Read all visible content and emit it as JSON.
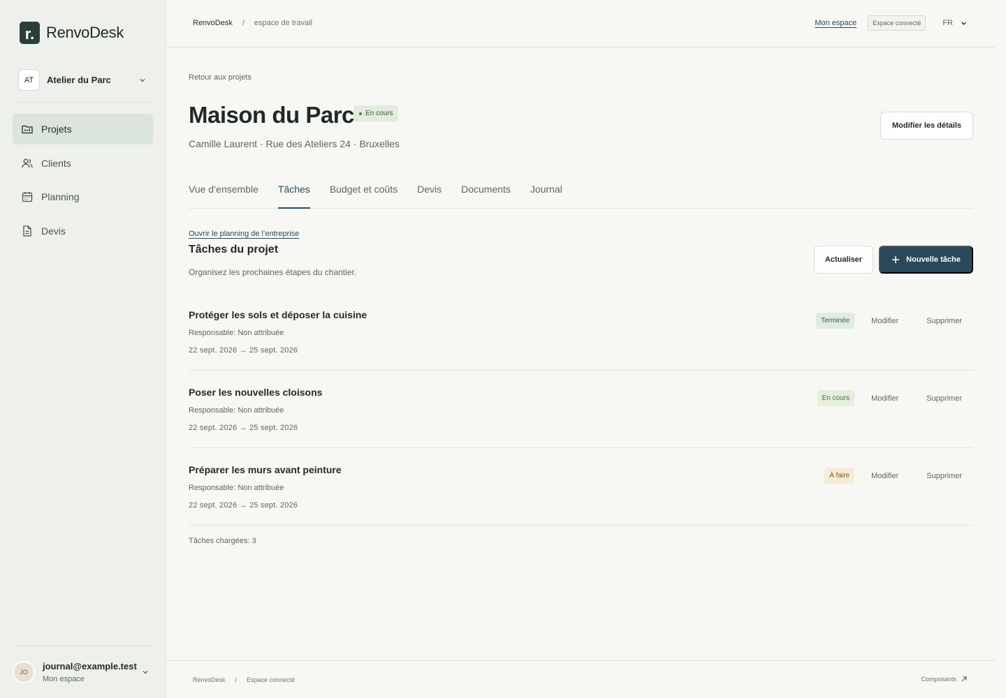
{
  "app": {
    "logo_letter": "r.",
    "name": "RenvoDesk"
  },
  "workspace": {
    "initials": "AT",
    "name": "Atelier du Parc"
  },
  "sidebar": {
    "items": [
      {
        "label": "Projets",
        "icon": "folder-icon",
        "active": true
      },
      {
        "label": "Clients",
        "icon": "users-icon",
        "active": false
      },
      {
        "label": "Planning",
        "icon": "calendar-icon",
        "active": false
      },
      {
        "label": "Devis",
        "icon": "document-icon",
        "active": false
      }
    ]
  },
  "user": {
    "initials": "JO",
    "email": "journal@example.test",
    "sub": "Mon espace"
  },
  "topbar": {
    "breadcrumb": [
      "RenvoDesk",
      "/",
      "espace de travail"
    ],
    "my_space": "Mon espace",
    "connected": "Espace connecté",
    "lang": "FR"
  },
  "project": {
    "back": "Retour aux projets",
    "title": "Maison du Parc",
    "status": "En cours",
    "subtitle": "Camille Laurent · Rue des Ateliers 24 · Bruxelles",
    "edit": "Modifier les détails"
  },
  "tabs": [
    {
      "label": "Vue d’ensemble",
      "active": false
    },
    {
      "label": "Tâches",
      "active": true
    },
    {
      "label": "Budget et coûts",
      "active": false
    },
    {
      "label": "Devis",
      "active": false
    },
    {
      "label": "Documents",
      "active": false
    },
    {
      "label": "Journal",
      "active": false
    }
  ],
  "tasks_section": {
    "open_planning": "Ouvrir le planning de l’entreprise",
    "title": "Tâches du projet",
    "description": "Organisez les prochaines étapes du chantier.",
    "refresh": "Actualiser",
    "new_task": "Nouvelle tâche",
    "count": "Tâches chargées: 3"
  },
  "tasks": [
    {
      "title": "Protéger les sols et déposer la cuisine",
      "responsible": "Responsable: Non attribuée",
      "dates": "22 sept. 2026 → 25 sept. 2026",
      "status": "Terminée",
      "status_kind": "done",
      "edit": "Modifier",
      "delete": "Supprimer"
    },
    {
      "title": "Poser les nouvelles cloisons",
      "responsible": "Responsable: Non attribuée",
      "dates": "22 sept. 2026 → 25 sept. 2026",
      "status": "En cours",
      "status_kind": "progress",
      "edit": "Modifier",
      "delete": "Supprimer"
    },
    {
      "title": "Préparer les murs avant peinture",
      "responsible": "Responsable: Non attribuée",
      "dates": "22 sept. 2026 → 25 sept. 2026",
      "status": "À faire",
      "status_kind": "todo",
      "edit": "Modifier",
      "delete": "Supprimer"
    }
  ],
  "footer": {
    "breadcrumb": [
      "RenvoDesk",
      "/",
      "Espace connecté"
    ],
    "components": "Composants"
  },
  "colors": {
    "accent": "#2a4a5c",
    "brand": "#2b3e37",
    "active_nav": "#dce5dc"
  }
}
